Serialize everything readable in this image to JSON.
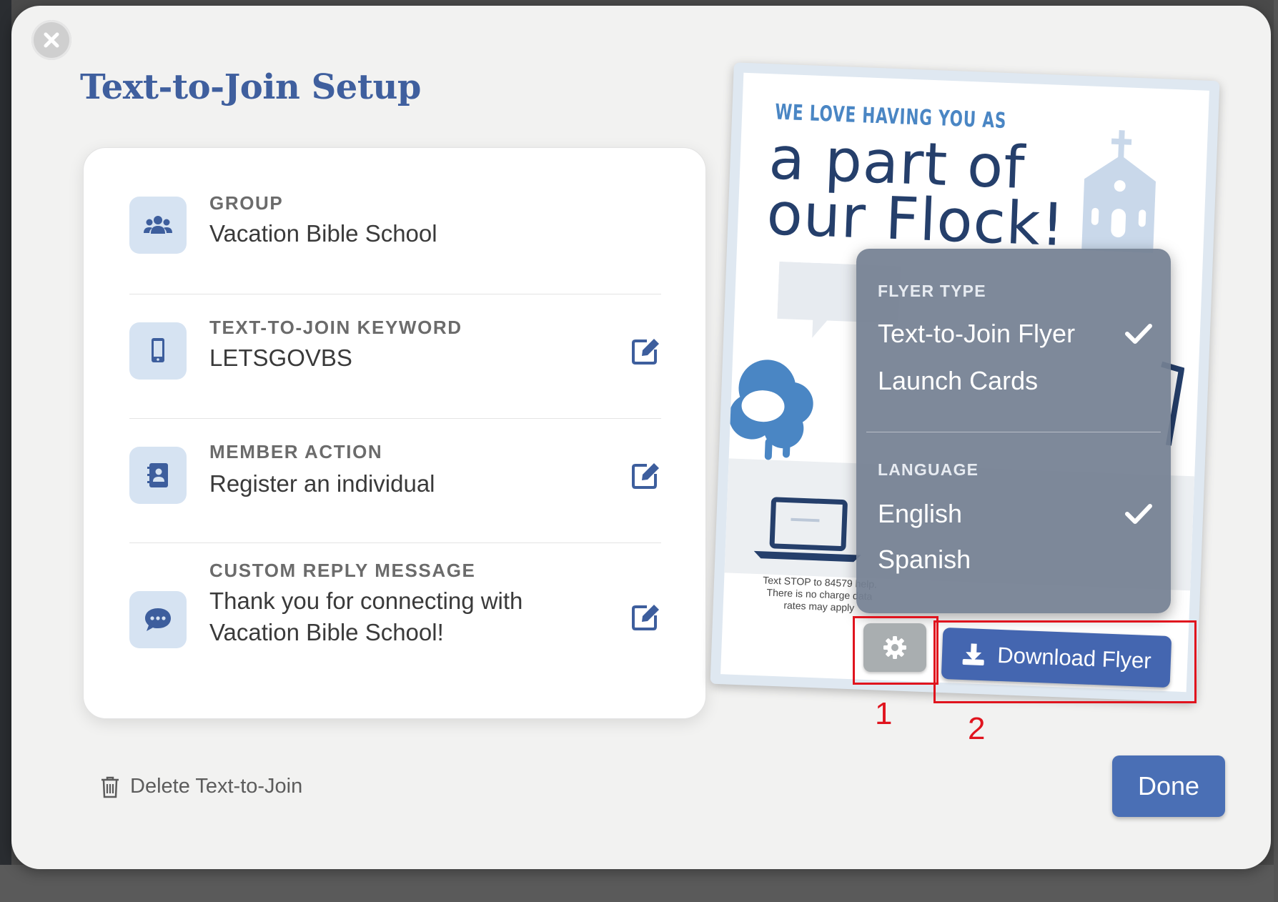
{
  "modal": {
    "title": "Text-to-Join Setup",
    "close_icon": "close-icon",
    "delete_label": "Delete Text-to-Join",
    "done_label": "Done"
  },
  "settings": [
    {
      "label": "GROUP",
      "value": "Vacation Bible School",
      "icon": "users-icon",
      "editable": false
    },
    {
      "label": "TEXT-TO-JOIN KEYWORD",
      "value": "LETSGOVBS",
      "icon": "mobile-phone-icon",
      "editable": true
    },
    {
      "label": "MEMBER ACTION",
      "value": "Register an individual",
      "icon": "contact-card-icon",
      "editable": true
    },
    {
      "label": "CUSTOM REPLY MESSAGE",
      "value": "Thank you for connecting with Vacation Bible School!",
      "icon": "chat-bubble-icon",
      "editable": true
    }
  ],
  "flyer_preview": {
    "kicker": "WE LOVE HAVING YOU AS",
    "headline_line1": "a part of",
    "headline_line2": "our Flock!",
    "fineprint": "Text STOP to 84579 help. There is no charge data rates may apply"
  },
  "flyer_menu": {
    "flyer_type_label": "FLYER TYPE",
    "flyer_types": [
      "Text-to-Join Flyer",
      "Launch Cards"
    ],
    "selected_flyer_type": "Text-to-Join Flyer",
    "language_label": "LANGUAGE",
    "languages": [
      "English",
      "Spanish"
    ],
    "selected_language": "English"
  },
  "actions": {
    "settings_icon": "gear-icon",
    "download_label": "Download Flyer"
  },
  "annotations": [
    "1",
    "2"
  ],
  "colors": {
    "accent": "#4a6fb5",
    "title": "#3f5f9e",
    "annotation": "#e0141e"
  }
}
